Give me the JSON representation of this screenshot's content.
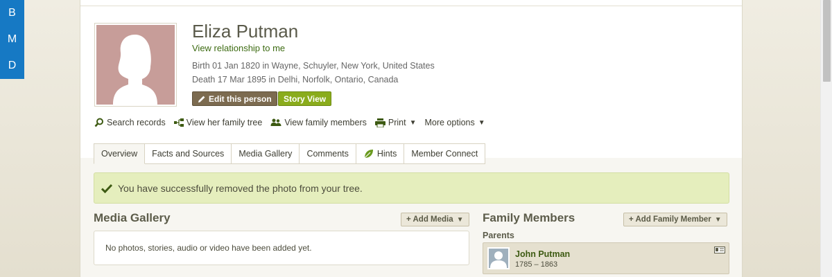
{
  "side_tab": {
    "letters": [
      "B",
      "M",
      "D"
    ]
  },
  "person": {
    "name": "Eliza Putman",
    "relationship_link": "View relationship to me",
    "birth": "Birth 01 Jan 1820 in Wayne, Schuyler, New York, United States",
    "death": "Death 17 Mar 1895 in Delhi, Norfolk, Ontario, Canada",
    "edit_label": "Edit this person",
    "story_label": "Story View"
  },
  "actions": {
    "search": "Search records",
    "tree": "View her family tree",
    "family": "View family members",
    "print": "Print",
    "more": "More options"
  },
  "tabs": [
    "Overview",
    "Facts and Sources",
    "Media Gallery",
    "Comments",
    "Hints",
    "Member Connect"
  ],
  "notice": "You have successfully removed the photo from your tree.",
  "media": {
    "title": "Media Gallery",
    "add_label": "+ Add Media",
    "empty": "No photos, stories, audio or video have been added yet."
  },
  "family": {
    "title": "Family Members",
    "add_label": "+ Add Family Member",
    "parents_label": "Parents",
    "parents": [
      {
        "name": "John Putman",
        "dates": "1785 – 1863"
      }
    ]
  },
  "colors": {
    "accent_green": "#8aac1c",
    "edit_brown": "#7c6b50",
    "notice_bg": "#e5eebd",
    "link_green": "#3d6b12",
    "side_blue": "#1679c4"
  }
}
